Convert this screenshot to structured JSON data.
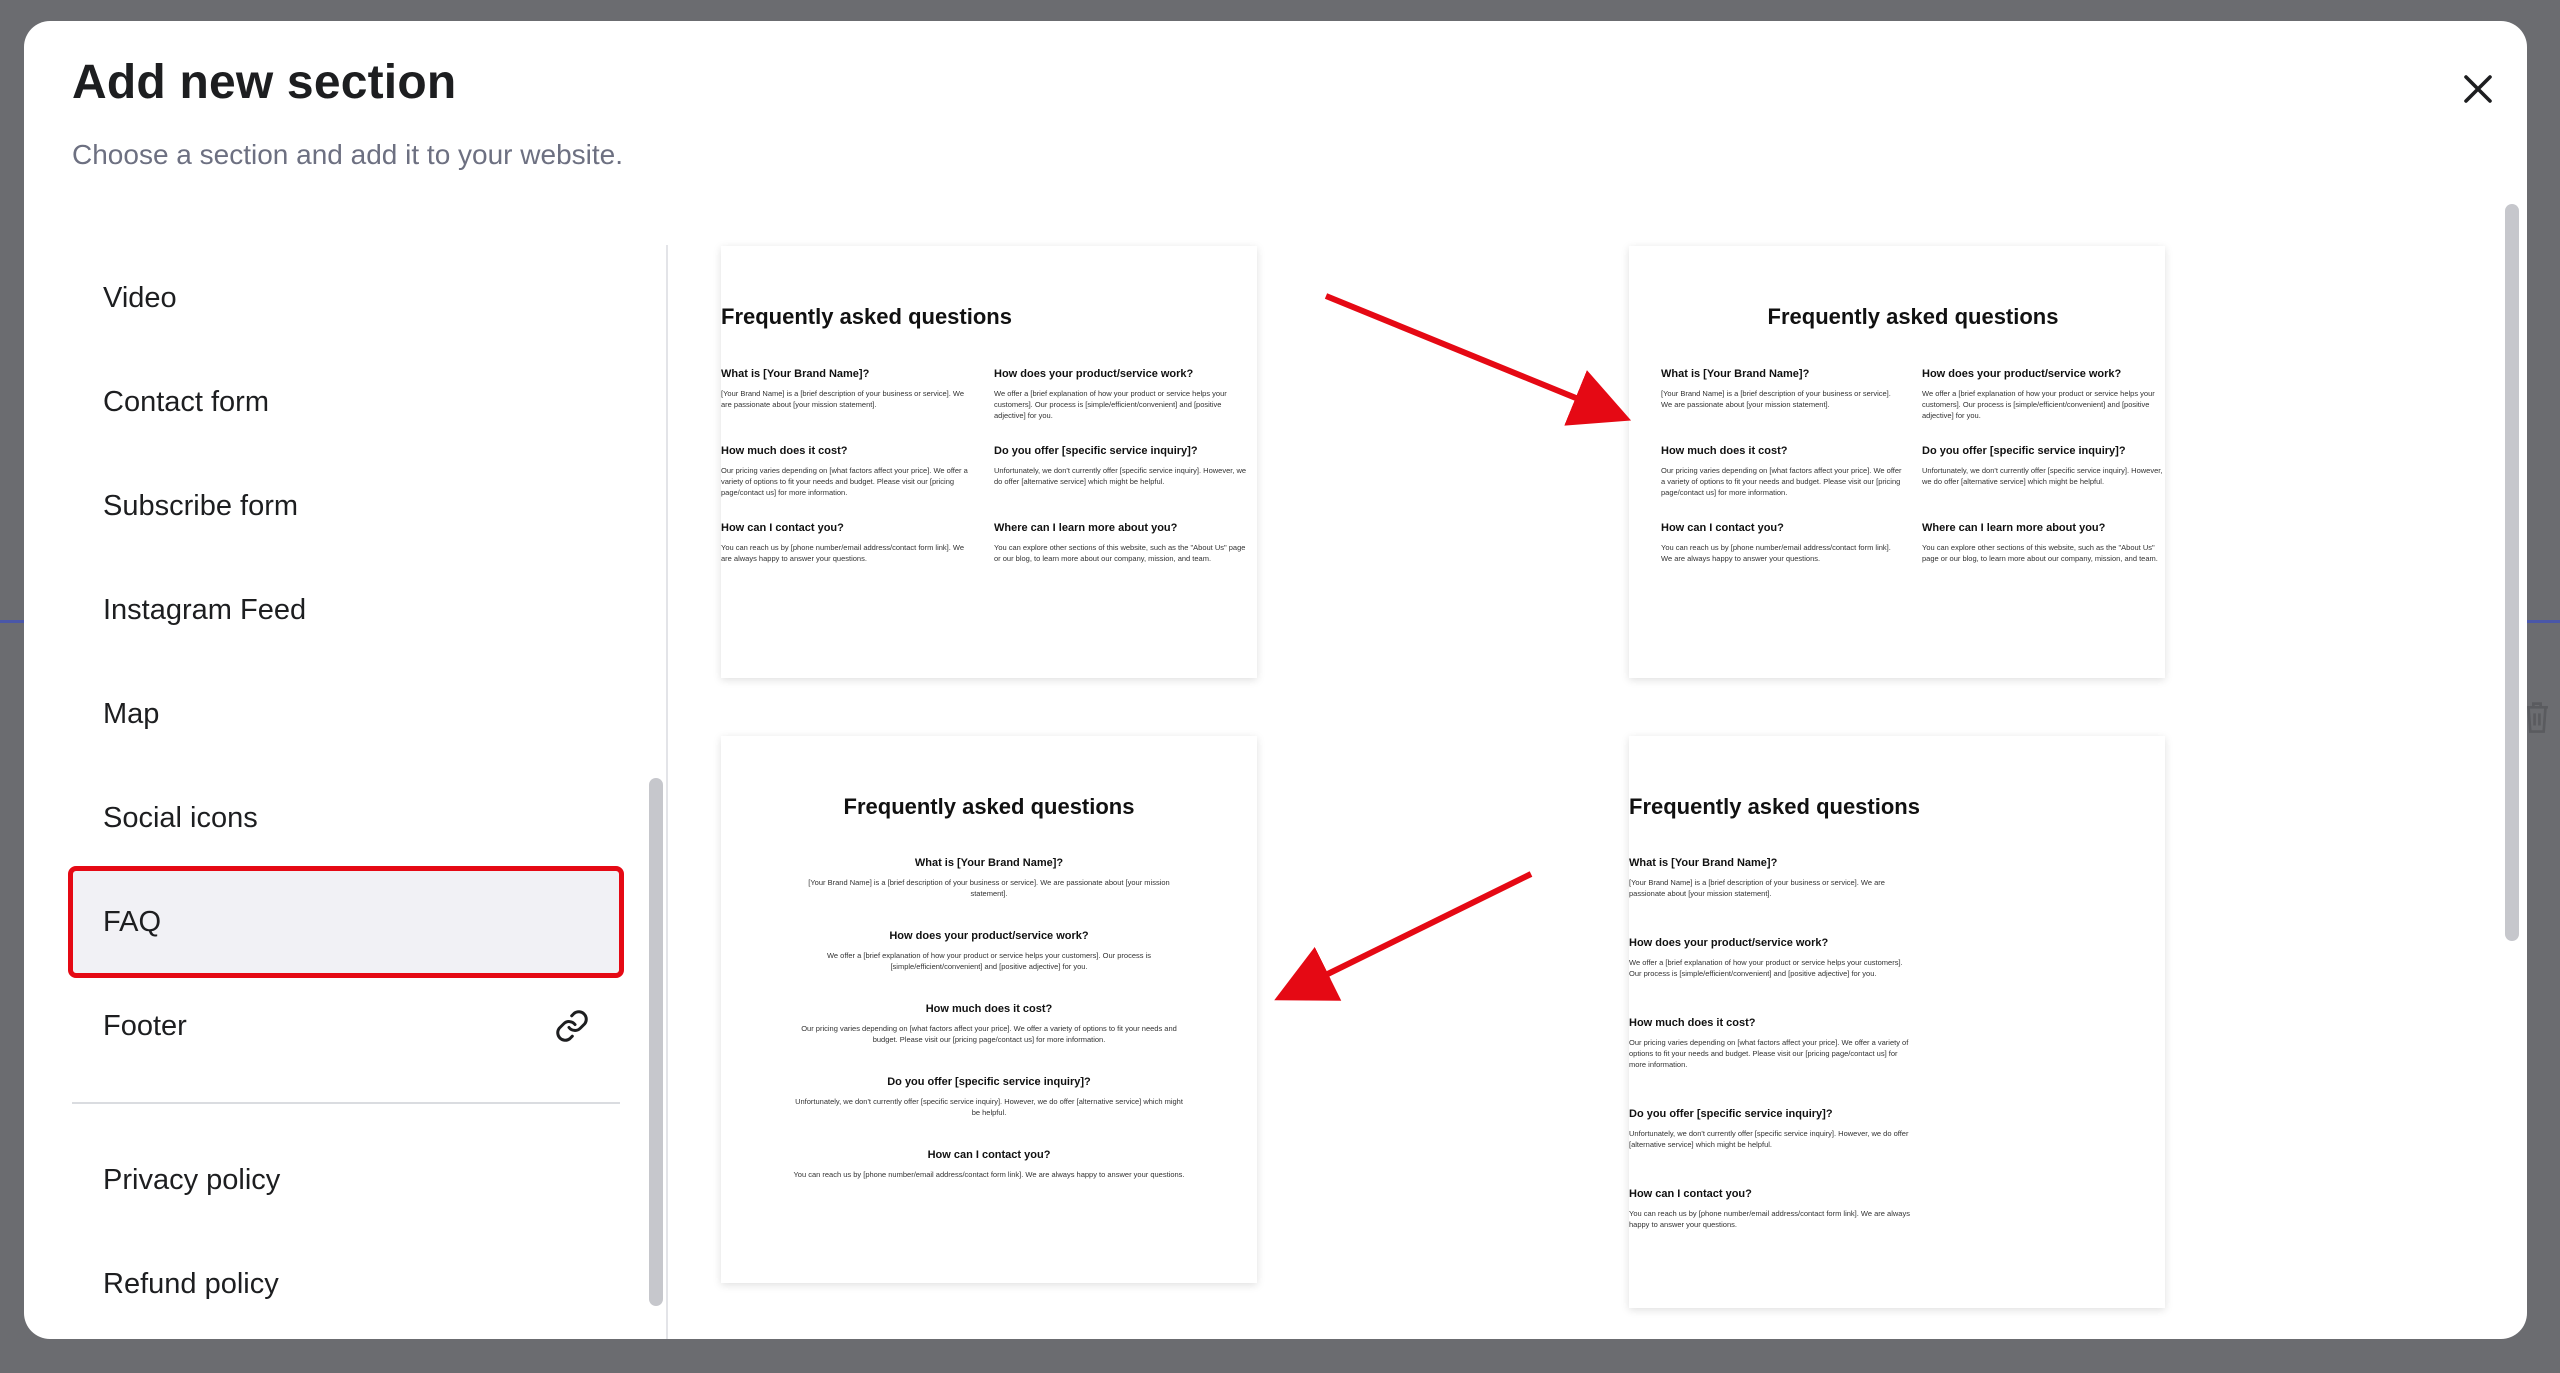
{
  "modal": {
    "title": "Add new section",
    "subtitle": "Choose a section and add it to your website."
  },
  "sidebar": {
    "items": [
      {
        "label": "Video"
      },
      {
        "label": "Contact form"
      },
      {
        "label": "Subscribe form"
      },
      {
        "label": "Instagram Feed"
      },
      {
        "label": "Map"
      },
      {
        "label": "Social icons"
      },
      {
        "label": "FAQ",
        "selected": true
      },
      {
        "label": "Footer",
        "icon": "link-icon"
      }
    ],
    "policies": [
      {
        "label": "Privacy policy"
      },
      {
        "label": "Refund policy"
      }
    ]
  },
  "faq": {
    "heading": "Frequently asked questions",
    "q1": "What is [Your Brand Name]?",
    "a1": "[Your Brand Name] is a [brief description of your business or service]. We are passionate about [your mission statement].",
    "q2": "How does your product/service work?",
    "a2": "We offer a [brief explanation of how your product or service helps your customers]. Our process is [simple/efficient/convenient] and [positive adjective] for you.",
    "q3": "How much does it cost?",
    "a3": "Our pricing varies depending on [what factors affect your price]. We offer a variety of options to fit your needs and budget. Please visit our [pricing page/contact us] for more information.",
    "q4": "Do you offer [specific service inquiry]?",
    "a4": "Unfortunately, we don't currently offer [specific service inquiry]. However, we do offer [alternative service] which might be helpful.",
    "q5": "How can I contact you?",
    "a5": "You can reach us by [phone number/email address/contact form link]. We are always happy to answer your questions.",
    "q6": "Where can I learn more about you?",
    "a6": "You can explore other sections of this website, such as the \"About Us\" page or our blog, to learn more about our company, mission, and team."
  },
  "colors": {
    "annotation_red": "#e50914",
    "overlay": "#6b6c70",
    "selected_bg": "#f1f1f5"
  },
  "icons": [
    "close-icon",
    "link-icon",
    "trash-icon"
  ]
}
